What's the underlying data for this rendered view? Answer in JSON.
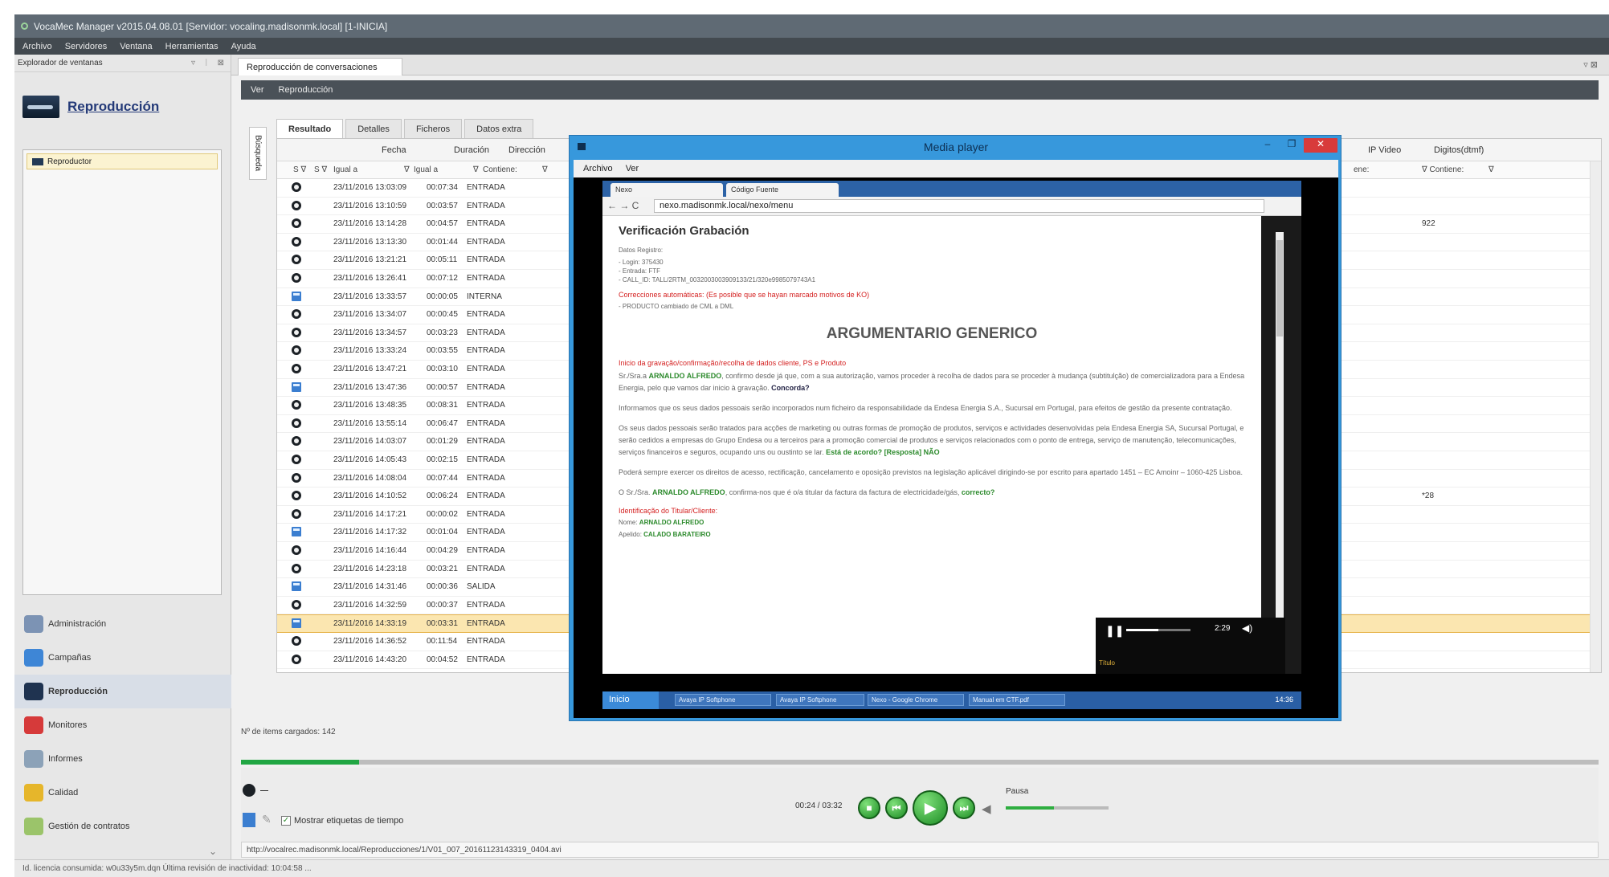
{
  "window": {
    "title": "VocaMec Manager v2015.04.08.01 [Servidor: vocaling.madisonmk.local] [1-INICIA]"
  },
  "menu": [
    "Archivo",
    "Servidores",
    "Ventana",
    "Herramientas",
    "Ayuda"
  ],
  "left": {
    "explorer_title": "Explorador de ventanas",
    "explorer_ctrls": [
      "▿",
      "ᛁ",
      "⊠"
    ],
    "section_title": "Reproducción",
    "tree_item": "Reproductor",
    "nav": [
      {
        "label": "Administración",
        "color": "#7c93b4"
      },
      {
        "label": "Campañas",
        "color": "#3e86d6"
      },
      {
        "label": "Reproducción",
        "color": "#1f3350"
      },
      {
        "label": "Monitores",
        "color": "#d63a3a"
      },
      {
        "label": "Informes",
        "color": "#8ca2b8"
      },
      {
        "label": "Calidad",
        "color": "#e6b62b"
      },
      {
        "label": "Gestión de contratos",
        "color": "#9bc46a"
      }
    ],
    "nav_active": 2,
    "collapse": "⌄"
  },
  "main": {
    "doc_tab": "Reproducción de conversaciones",
    "doc_ctrls": "▿ ⊠",
    "subbar": [
      "Ver",
      "Reproducción"
    ],
    "search_tab": "Búsqueda",
    "result_tabs": [
      "Resultado",
      "Detalles",
      "Ficheros",
      "Datos extra"
    ],
    "columns": {
      "fecha": "Fecha",
      "duracion": "Duración",
      "direccion": "Dirección",
      "ipvideo": "IP Video",
      "digitos": "Digitos(dtmf)"
    },
    "filters": {
      "s": "S ∇",
      "sv": "S ∇",
      "fecha": "Igual a",
      "fecha_ico": "∇",
      "duracion": "Igual a",
      "duracion_ico": "∇",
      "direccion": "Contiene:",
      "direccion_ico": "∇",
      "extra": "ene:",
      "digitos": "∇ Contiene:",
      "digitos_ico": "∇"
    },
    "rows": [
      {
        "fecha": "23/11/2016 13:03:09",
        "dur": "00:07:34",
        "dir": "ENTRADA",
        "icon": "disc",
        "dig": ""
      },
      {
        "fecha": "23/11/2016 13:10:59",
        "dur": "00:03:57",
        "dir": "ENTRADA",
        "icon": "disc",
        "dig": ""
      },
      {
        "fecha": "23/11/2016 13:14:28",
        "dur": "00:04:57",
        "dir": "ENTRADA",
        "icon": "disc",
        "dig": "922"
      },
      {
        "fecha": "23/11/2016 13:13:30",
        "dur": "00:01:44",
        "dir": "ENTRADA",
        "icon": "disc",
        "dig": ""
      },
      {
        "fecha": "23/11/2016 13:21:21",
        "dur": "00:05:11",
        "dir": "ENTRADA",
        "icon": "disc",
        "dig": ""
      },
      {
        "fecha": "23/11/2016 13:26:41",
        "dur": "00:07:12",
        "dir": "ENTRADA",
        "icon": "disc",
        "dig": ""
      },
      {
        "fecha": "23/11/2016 13:33:57",
        "dur": "00:00:05",
        "dir": "INTERNA",
        "icon": "doc",
        "dig": ""
      },
      {
        "fecha": "23/11/2016 13:34:07",
        "dur": "00:00:45",
        "dir": "ENTRADA",
        "icon": "disc",
        "dig": ""
      },
      {
        "fecha": "23/11/2016 13:34:57",
        "dur": "00:03:23",
        "dir": "ENTRADA",
        "icon": "disc",
        "dig": ""
      },
      {
        "fecha": "23/11/2016 13:33:24",
        "dur": "00:03:55",
        "dir": "ENTRADA",
        "icon": "disc",
        "dig": ""
      },
      {
        "fecha": "23/11/2016 13:47:21",
        "dur": "00:03:10",
        "dir": "ENTRADA",
        "icon": "disc",
        "dig": ""
      },
      {
        "fecha": "23/11/2016 13:47:36",
        "dur": "00:00:57",
        "dir": "ENTRADA",
        "icon": "doc",
        "dig": ""
      },
      {
        "fecha": "23/11/2016 13:48:35",
        "dur": "00:08:31",
        "dir": "ENTRADA",
        "icon": "disc",
        "dig": ""
      },
      {
        "fecha": "23/11/2016 13:55:14",
        "dur": "00:06:47",
        "dir": "ENTRADA",
        "icon": "disc",
        "dig": ""
      },
      {
        "fecha": "23/11/2016 14:03:07",
        "dur": "00:01:29",
        "dir": "ENTRADA",
        "icon": "disc",
        "dig": ""
      },
      {
        "fecha": "23/11/2016 14:05:43",
        "dur": "00:02:15",
        "dir": "ENTRADA",
        "icon": "disc",
        "dig": ""
      },
      {
        "fecha": "23/11/2016 14:08:04",
        "dur": "00:07:44",
        "dir": "ENTRADA",
        "icon": "disc",
        "dig": ""
      },
      {
        "fecha": "23/11/2016 14:10:52",
        "dur": "00:06:24",
        "dir": "ENTRADA",
        "icon": "disc",
        "dig": "*28"
      },
      {
        "fecha": "23/11/2016 14:17:21",
        "dur": "00:00:02",
        "dir": "ENTRADA",
        "icon": "disc",
        "dig": ""
      },
      {
        "fecha": "23/11/2016 14:17:32",
        "dur": "00:01:04",
        "dir": "ENTRADA",
        "icon": "doc",
        "dig": ""
      },
      {
        "fecha": "23/11/2016 14:16:44",
        "dur": "00:04:29",
        "dir": "ENTRADA",
        "icon": "disc",
        "dig": ""
      },
      {
        "fecha": "23/11/2016 14:23:18",
        "dur": "00:03:21",
        "dir": "ENTRADA",
        "icon": "disc",
        "dig": ""
      },
      {
        "fecha": "23/11/2016 14:31:46",
        "dur": "00:00:36",
        "dir": "SALIDA",
        "icon": "doc",
        "dig": ""
      },
      {
        "fecha": "23/11/2016 14:32:59",
        "dur": "00:00:37",
        "dir": "ENTRADA",
        "icon": "disc",
        "dig": ""
      },
      {
        "fecha": "23/11/2016 14:33:19",
        "dur": "00:03:31",
        "dir": "ENTRADA",
        "icon": "doc",
        "dig": "",
        "selected": true
      },
      {
        "fecha": "23/11/2016 14:36:52",
        "dur": "00:11:54",
        "dir": "ENTRADA",
        "icon": "disc",
        "dig": ""
      },
      {
        "fecha": "23/11/2016 14:43:20",
        "dur": "00:04:52",
        "dir": "ENTRADA",
        "icon": "disc",
        "dig": ""
      }
    ],
    "loaded_label": "Nº de items cargados: 142",
    "progress": 0.087,
    "show_time_labels": "Mostrar etiquetas de tiempo",
    "time": "00:24 / 03:32",
    "pause_label": "Pausa",
    "url": "http://vocalrec.madisonmk.local/Reproducciones/1/V01_007_20161123143319_0404.avi"
  },
  "media_player": {
    "title": "Media player",
    "ctrls": [
      "–",
      "❐",
      "✕"
    ],
    "menu": [
      "Archivo",
      "Ver"
    ],
    "chrome_tabs": [
      "Nexo",
      "Código Fuente"
    ],
    "address": "nexo.madisonmk.local/nexo/menu",
    "page": {
      "heading": "Verificación Grabación",
      "datos": "Datos Registro:",
      "meta1": "- Login: 375430",
      "meta2": "- Entrada: FTF",
      "meta3": "- CALL_ID: TALL/2RTM_0032003003909133/21/320e9985079743A1",
      "correcciones": "Correcciones automáticas: (Es posible que se hayan marcado motivos de KO)",
      "producto": "- PRODUCTO cambiado de CML a DML",
      "big_title": "ARGUMENTARIO GENERICO",
      "inicio": "Inicio da gravação/confirmação/recolha de dados cliente, PS e Produto",
      "p1a": "Sr./Sra.a ",
      "p1name": "ARNALDO ALFREDO",
      "p1b": ", confirmo desde já que, com a sua autorização, vamos proceder à recolha de dados para se proceder à mudança (subtitulção) de comercializadora para a Endesa Energia, pelo que vamos dar inicio à gravação. ",
      "p1c": "Concorda?",
      "p2": "Informamos que os seus dados pessoais serão incorporados num ficheiro da responsabilidade da Endesa Energia S.A., Sucursal em Portugal, para efeitos de gestão da presente contratação.",
      "p3a": "Os seus dados pessoais serão tratados para acções de marketing ou outras formas de promoção de produtos, serviços e actividades desenvolvidas pela Endesa Energia SA, Sucursal Portugal, e serão cedidos a empresas do Grupo Endesa ou a terceiros para a promoção comercial de produtos e serviços relacionados com o ponto de entrega, serviço de manutenção, telecomunicações, serviços financeiros e seguros, ocupando uns ou oustinto se lar. ",
      "p3b": "Está de acordo? [Resposta] NÃO",
      "p4": "Poderá sempre exercer os direitos de acesso, rectificação, cancelamento e oposição previstos na legislação aplicável dirigindo-se por escrito para apartado 1451 – EC Amoinr – 1060-425 Lisboa.",
      "p5a": "O Sr./Sra. ",
      "p5name": "ARNALDO ALFREDO",
      "p5b": ", confirma-nos que é o/a titular da factura da factura de electricidade/gás, ",
      "p5c": "correcto?",
      "identif": "Identificação do Titular/Cliente:",
      "nome_l": "Nome: ",
      "nome_v": "ARNALDO ALFREDO",
      "apel_l": "Apelido: ",
      "apel_v": "CALADO BARATEIRO"
    },
    "video_time": "2:29",
    "video_label": "Título",
    "taskbar": [
      "Inicio",
      "Avaya IP Softphone",
      "Avaya IP Softphone",
      "Nexo - Google Chrome",
      "Manual em CTF.pdf"
    ],
    "clock": "14:36"
  },
  "status": "Id. licencia consumida: w0u33y5m.dqn   Última revisión de inactividad: 10:04:58  ..."
}
